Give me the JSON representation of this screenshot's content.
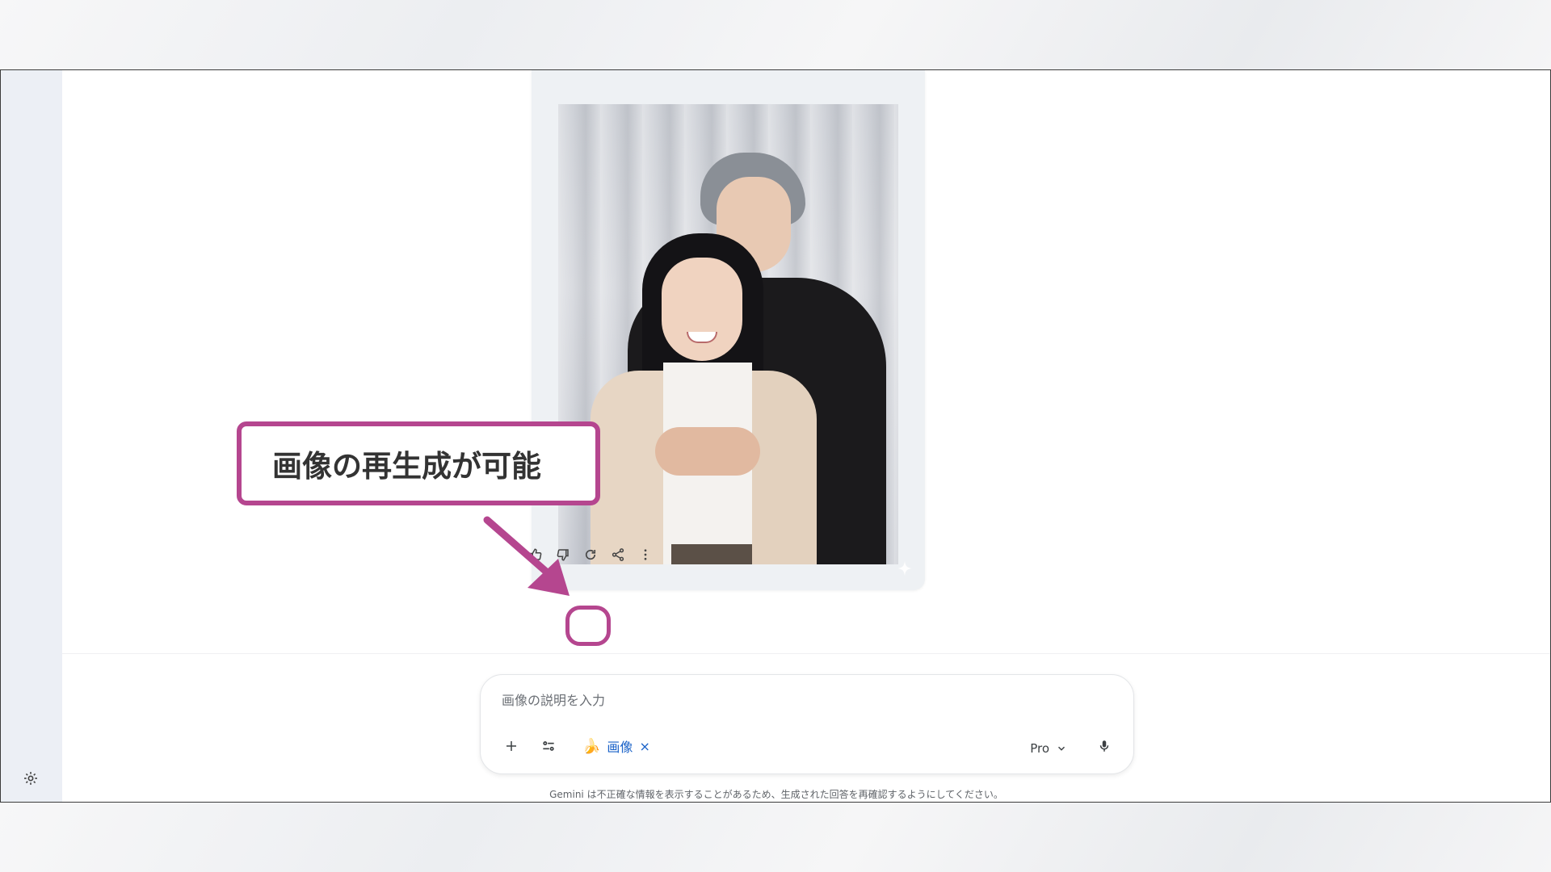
{
  "callout": {
    "text": "画像の再生成が可能"
  },
  "response_actions": {
    "items": [
      {
        "icon": "thumbs-up-icon"
      },
      {
        "icon": "thumbs-down-icon"
      },
      {
        "icon": "regenerate-icon"
      },
      {
        "icon": "share-icon"
      },
      {
        "icon": "more-vert-icon"
      }
    ]
  },
  "composer": {
    "placeholder": "画像の説明を入力",
    "chip_label": "画像",
    "chip_close": "×",
    "model": "Pro"
  },
  "disclaimer": "Gemini は不正確な情報を表示することがあるため、生成された回答を再確認するようにしてください。",
  "colors": {
    "accent": "#b5468f",
    "chip_text": "#1a62c8"
  }
}
